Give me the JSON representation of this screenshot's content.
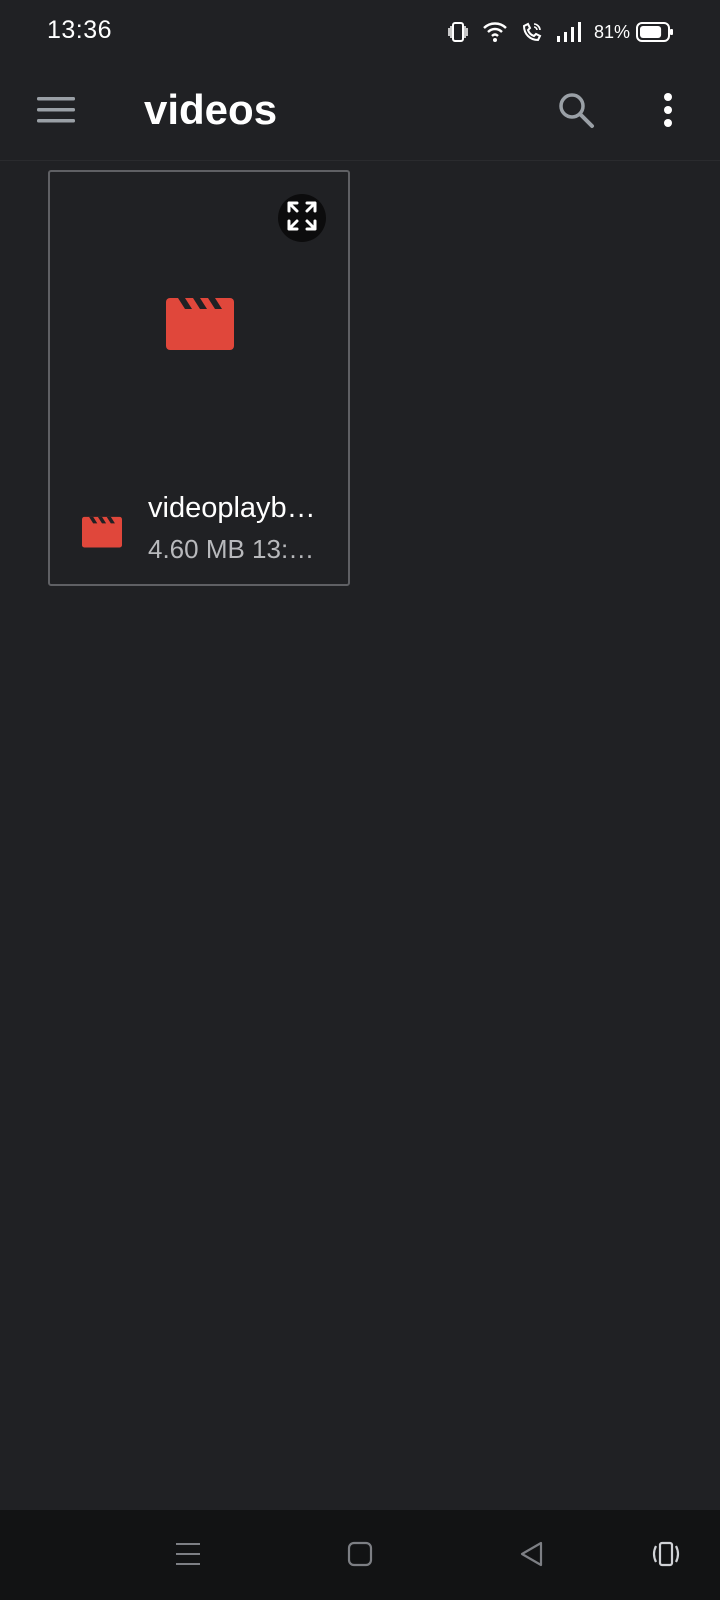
{
  "status_bar": {
    "time": "13:36",
    "battery_percent": "81%",
    "battery_level": 0.81,
    "icons": [
      "vibrate-icon",
      "wifi-icon",
      "wifi-calling-icon",
      "signal-icon",
      "battery-icon"
    ]
  },
  "app_bar": {
    "title": "videos",
    "icons": [
      "menu-icon",
      "search-icon",
      "more-vert-icon"
    ]
  },
  "files": [
    {
      "name": "videoplayb…",
      "meta": "4.60 MB 13:…",
      "type_icon": "video-clapper-icon",
      "accent_color": "#e0473b"
    }
  ],
  "nav_bar": {
    "icons": [
      "recents-icon",
      "home-icon",
      "back-icon",
      "rotate-icon"
    ]
  },
  "colors": {
    "background": "#202124",
    "card_border": "#5f6064",
    "accent": "#e0473b",
    "nav_background": "#121314"
  }
}
